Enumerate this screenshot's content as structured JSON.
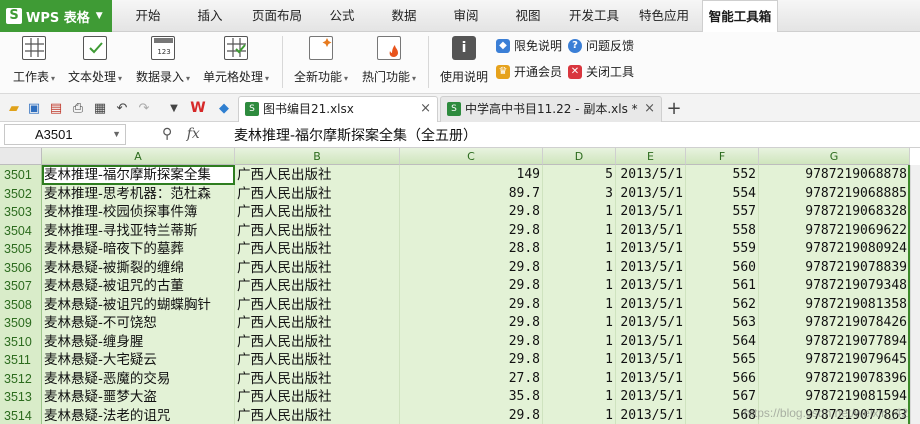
{
  "app": {
    "name": "WPS 表格"
  },
  "menu_tabs": [
    "开始",
    "插入",
    "页面布局",
    "公式",
    "数据",
    "审阅",
    "视图",
    "开发工具",
    "特色应用",
    "智能工具箱"
  ],
  "active_tab": "智能工具箱",
  "toolbar": {
    "buttons": [
      {
        "label": "工作表",
        "icon": "grid-sheet-icon"
      },
      {
        "label": "文本处理",
        "icon": "text-process-icon"
      },
      {
        "label": "数据录入",
        "icon": "data-entry-icon"
      },
      {
        "label": "单元格处理",
        "icon": "cell-process-icon"
      },
      {
        "label": "全新功能",
        "icon": "new-feature-icon"
      },
      {
        "label": "热门功能",
        "icon": "hot-feature-icon"
      },
      {
        "label": "使用说明",
        "icon": "info-icon"
      }
    ],
    "small": [
      {
        "label": "限免说明",
        "icon": "tag-icon"
      },
      {
        "label": "问题反馈",
        "icon": "help-icon"
      },
      {
        "label": "开通会员",
        "icon": "crown-icon"
      },
      {
        "label": "关闭工具",
        "icon": "close-box-icon"
      }
    ]
  },
  "documents": [
    {
      "name": "图书编目21.xlsx",
      "active": true
    },
    {
      "name": "中学高中书目11.22 - 副本.xls *",
      "active": false
    }
  ],
  "formula_bar": {
    "cell_ref": "A3501",
    "fx": "fx",
    "content": "麦林推理-福尔摩斯探案全集（全五册）"
  },
  "columns": [
    "A",
    "B",
    "C",
    "D",
    "E",
    "F",
    "G"
  ],
  "rows": [
    {
      "n": "3501",
      "a": "麦林推理-福尔摩斯探案全集",
      "b": "广西人民出版社",
      "c": "149",
      "d": "5",
      "e": "2013/5/1",
      "f": "552",
      "g": "9787219068878"
    },
    {
      "n": "3502",
      "a": "麦林推理-思考机器：范杜森",
      "b": "广西人民出版社",
      "c": "89.7",
      "d": "3",
      "e": "2013/5/1",
      "f": "554",
      "g": "9787219068885"
    },
    {
      "n": "3503",
      "a": "麦林推理-校园侦探事件簿",
      "b": "广西人民出版社",
      "c": "29.8",
      "d": "1",
      "e": "2013/5/1",
      "f": "557",
      "g": "9787219068328"
    },
    {
      "n": "3504",
      "a": "麦林推理-寻找亚特兰蒂斯",
      "b": "广西人民出版社",
      "c": "29.8",
      "d": "1",
      "e": "2013/5/1",
      "f": "558",
      "g": "9787219069622"
    },
    {
      "n": "3505",
      "a": "麦林悬疑-暗夜下的墓葬",
      "b": "广西人民出版社",
      "c": "28.8",
      "d": "1",
      "e": "2013/5/1",
      "f": "559",
      "g": "9787219080924"
    },
    {
      "n": "3506",
      "a": "麦林悬疑-被撕裂的缠绵",
      "b": "广西人民出版社",
      "c": "29.8",
      "d": "1",
      "e": "2013/5/1",
      "f": "560",
      "g": "9787219078839"
    },
    {
      "n": "3507",
      "a": "麦林悬疑-被诅咒的古董",
      "b": "广西人民出版社",
      "c": "29.8",
      "d": "1",
      "e": "2013/5/1",
      "f": "561",
      "g": "9787219079348"
    },
    {
      "n": "3508",
      "a": "麦林悬疑-被诅咒的蝴蝶胸针",
      "b": "广西人民出版社",
      "c": "29.8",
      "d": "1",
      "e": "2013/5/1",
      "f": "562",
      "g": "9787219081358"
    },
    {
      "n": "3509",
      "a": "麦林悬疑-不可饶恕",
      "b": "广西人民出版社",
      "c": "29.8",
      "d": "1",
      "e": "2013/5/1",
      "f": "563",
      "g": "9787219078426"
    },
    {
      "n": "3510",
      "a": "麦林悬疑-缠身腥",
      "b": "广西人民出版社",
      "c": "29.8",
      "d": "1",
      "e": "2013/5/1",
      "f": "564",
      "g": "9787219077894"
    },
    {
      "n": "3511",
      "a": "麦林悬疑-大宅疑云",
      "b": "广西人民出版社",
      "c": "29.8",
      "d": "1",
      "e": "2013/5/1",
      "f": "565",
      "g": "9787219079645"
    },
    {
      "n": "3512",
      "a": "麦林悬疑-恶魔的交易",
      "b": "广西人民出版社",
      "c": "27.8",
      "d": "1",
      "e": "2013/5/1",
      "f": "566",
      "g": "9787219078396"
    },
    {
      "n": "3513",
      "a": "麦林悬疑-噩梦大盗",
      "b": "广西人民出版社",
      "c": "35.8",
      "d": "1",
      "e": "2013/5/1",
      "f": "567",
      "g": "9787219081594"
    },
    {
      "n": "3514",
      "a": "麦林悬疑-法老的诅咒",
      "b": "广西人民出版社",
      "c": "29.8",
      "d": "1",
      "e": "2013/5/1",
      "f": "568",
      "g": "9787219077863"
    }
  ],
  "watermark": "https://blog.csdn.net/weixin_42",
  "colors": {
    "accent": "#3f9b35",
    "selection": "#e3f2d6",
    "row_header": "#d9ecc9"
  }
}
